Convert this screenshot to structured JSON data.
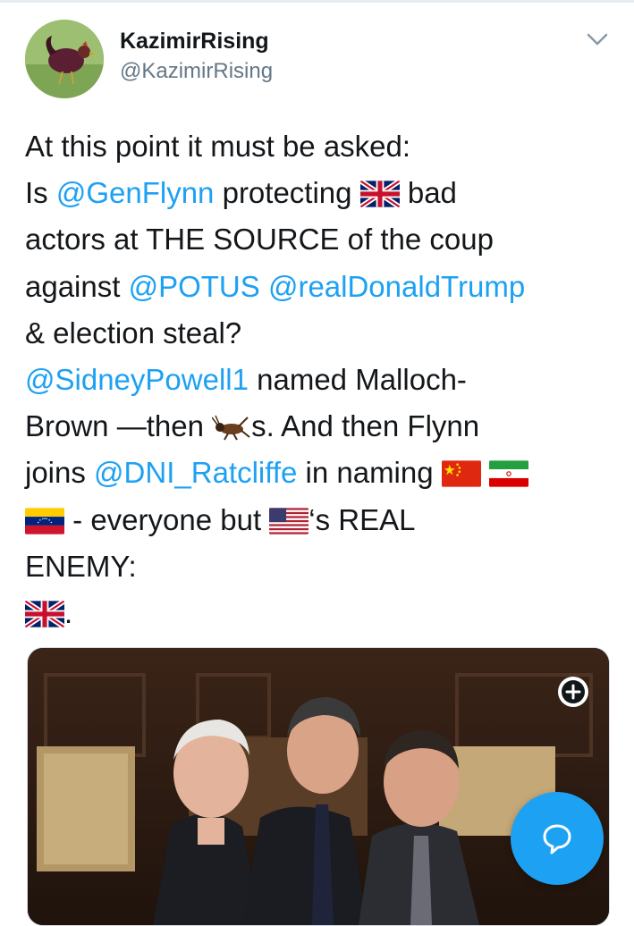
{
  "tweet": {
    "display_name": "KazimirRising",
    "handle": "@KazimirRising",
    "text": {
      "l1": "At this point it must be asked:",
      "l2a": "Is ",
      "l2_mention": "@GenFlynn",
      "l2b": " protecting ",
      "l2c": " bad",
      "l3": "actors at THE SOURCE of the coup",
      "l4a": "against ",
      "l4_mention1": "@POTUS",
      "l4_space": " ",
      "l4_mention2": "@realDonaldTrump",
      "l5": "& election steal?",
      "l6_mention": "@SidneyPowell1",
      "l6b": " named Malloch-",
      "l7a": "Brown —then ",
      "l7b": "s. And then Flynn",
      "l8a": "joins ",
      "l8_mention": "@DNI_Ratcliffe",
      "l8b": " in naming ",
      "l9a": " - everyone but ",
      "l9b": "‘s REAL",
      "l10": "ENEMY:",
      "l11": "."
    },
    "emoji": [
      "uk-flag",
      "cricket",
      "china-flag",
      "iran-flag",
      "venezuela-flag",
      "us-flag",
      "uk-flag"
    ]
  },
  "colors": {
    "link": "#1da1f2",
    "text": "#14171a",
    "muted": "#657786",
    "fab": "#1da1f2"
  },
  "icons": {
    "menu": "chevron-down-icon",
    "media_expand": "plus-circle-icon",
    "compose": "reply-bubble-icon"
  }
}
